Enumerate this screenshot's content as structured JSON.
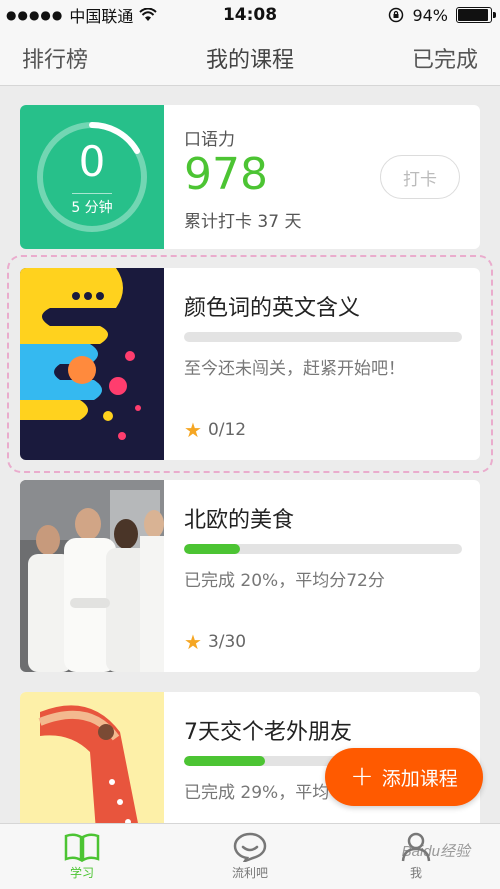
{
  "status_bar": {
    "carrier": "中国联通",
    "time": "14:08",
    "battery": "94%"
  },
  "nav": {
    "left": "排行榜",
    "title": "我的课程",
    "right": "已完成"
  },
  "oral_card": {
    "ring_value": "0",
    "ring_unit": "5 分钟",
    "label": "口语力",
    "score": "978",
    "total": "累计打卡 37 天",
    "checkin_button": "打卡"
  },
  "courses": [
    {
      "title": "颜色词的英文含义",
      "progress": 0,
      "status": "至今还未闯关，赶紧开始吧！",
      "stars": "0/12",
      "thumb": "color-art-thumbnail"
    },
    {
      "title": "北欧的美食",
      "progress": 20,
      "status": "已完成 20%，平均分72分",
      "stars": "3/30",
      "thumb": "chefs-photo-thumbnail"
    },
    {
      "title": "7天交个老外朋友",
      "progress": 29,
      "status": "已完成 29%，平均",
      "stars": "",
      "thumb": "friendship-illustration-thumbnail"
    }
  ],
  "fab": {
    "label": "添加课程"
  },
  "tabs": [
    {
      "label": "学习",
      "icon": "book-icon",
      "active": true
    },
    {
      "label": "流利吧",
      "icon": "chat-bubble-icon",
      "active": false
    },
    {
      "label": "我",
      "icon": "person-icon",
      "active": false
    }
  ],
  "watermark": "Baidu经验",
  "colors": {
    "accent_green": "#4cc433",
    "fab_orange": "#ff5a00",
    "oral_bg": "#27c08a"
  }
}
